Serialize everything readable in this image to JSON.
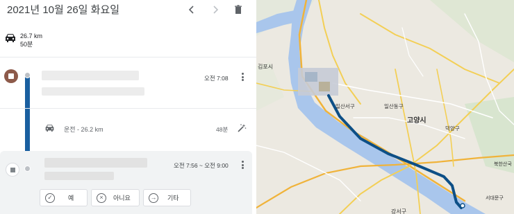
{
  "header": {
    "date": "2021년 10월 26일 화요일",
    "prev_icon": "chevron-left-icon",
    "next_icon": "chevron-right-icon",
    "delete_icon": "trash-icon"
  },
  "summary": {
    "distance": "26.7 km",
    "duration": "50분"
  },
  "visit1": {
    "time": "오전 7:08"
  },
  "drive": {
    "label": "운전 - 26.2 km",
    "duration": "48분"
  },
  "visit2": {
    "time": "오전 7:56 ~ 오전 9:00",
    "buttons": {
      "yes": "예",
      "no": "아니요",
      "other": "기타"
    }
  },
  "map": {
    "labels": {
      "gimpo": "김포시",
      "goyang": "고양시",
      "ilsanseogu": "일산서구",
      "ilsandonggu": "일산동구",
      "deogyanggu": "덕양구",
      "bukhansan": "북한산국",
      "seodaemungu": "서대문구",
      "gangseogu": "강서구"
    },
    "route_color": "#0d4f86",
    "river_color": "#a9c6ec"
  }
}
